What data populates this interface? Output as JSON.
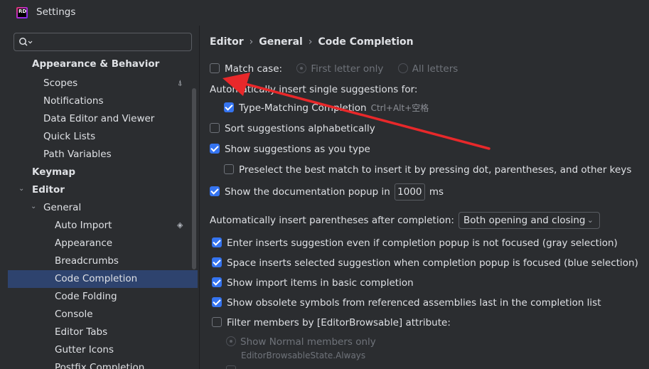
{
  "window": {
    "title": "Settings",
    "logo_text": "RD"
  },
  "sidebar": {
    "search_placeholder": "",
    "items": [
      {
        "label": "Appearance & Behavior"
      },
      {
        "label": "Scopes"
      },
      {
        "label": "Notifications"
      },
      {
        "label": "Data Editor and Viewer"
      },
      {
        "label": "Quick Lists"
      },
      {
        "label": "Path Variables"
      },
      {
        "label": "Keymap"
      },
      {
        "label": "Editor"
      },
      {
        "label": "General"
      },
      {
        "label": "Auto Import"
      },
      {
        "label": "Appearance"
      },
      {
        "label": "Breadcrumbs"
      },
      {
        "label": "Code Completion"
      },
      {
        "label": "Code Folding"
      },
      {
        "label": "Console"
      },
      {
        "label": "Editor Tabs"
      },
      {
        "label": "Gutter Icons"
      },
      {
        "label": "Postfix Completion"
      }
    ],
    "selected": "Code Completion"
  },
  "breadcrumb": [
    "Editor",
    "General",
    "Code Completion"
  ],
  "options": {
    "match_case": {
      "label": "Match case:",
      "checked": false
    },
    "first_letter_only": "First letter only",
    "all_letters": "All letters",
    "auto_insert_heading": "Automatically insert single suggestions for:",
    "type_matching": {
      "label": "Type-Matching Completion",
      "shortcut": "Ctrl+Alt+空格",
      "checked": true
    },
    "sort_alpha": {
      "label": "Sort suggestions alphabetically",
      "checked": false
    },
    "show_as_type": {
      "label": "Show suggestions as you type",
      "checked": true
    },
    "preselect": {
      "label": "Preselect the best match to insert it by pressing dot, parentheses, and other keys",
      "checked": false
    },
    "doc_popup": {
      "label": "Show the documentation popup in",
      "value": "1000",
      "unit": "ms",
      "checked": true
    },
    "parens_label": "Automatically insert parentheses after completion:",
    "parens_value": "Both opening and closing",
    "enter_inserts": {
      "label": "Enter inserts suggestion even if completion popup is not focused (gray selection)",
      "checked": true
    },
    "space_inserts": {
      "label": "Space inserts selected suggestion when completion popup is focused (blue selection)",
      "checked": true
    },
    "import_items": {
      "label": "Show import items in basic completion",
      "checked": true
    },
    "obsolete": {
      "label": "Show obsolete symbols from referenced assemblies last in the completion list",
      "checked": true
    },
    "filter_members": {
      "label": "Filter members by [EditorBrowsable] attribute:",
      "checked": false
    },
    "show_normal": "Show Normal members only",
    "browsable_always": "EditorBrowsableState.Always"
  },
  "colors": {
    "accent": "#3574f0",
    "selection": "#2e436e",
    "arrow": "#e8282a",
    "background": "#2b2d30"
  }
}
